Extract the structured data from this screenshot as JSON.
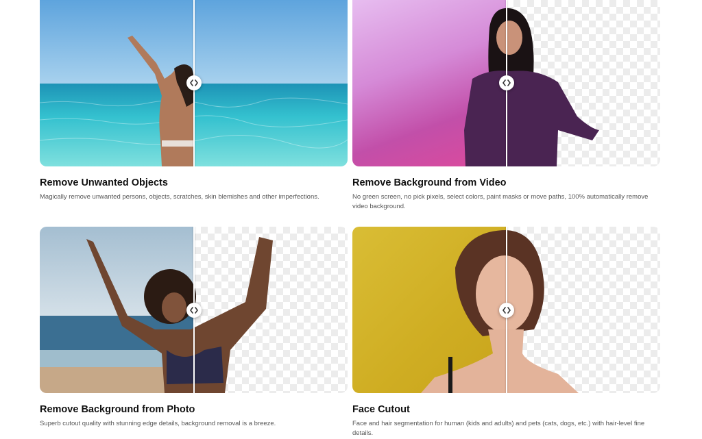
{
  "features": [
    {
      "title": "Remove Unwanted Objects",
      "description": "Magically remove unwanted persons, objects, scratches, skin blemishes and other imperfections.",
      "compare_position": 0.5,
      "handle_icon": "chevrons-left-right-icon"
    },
    {
      "title": "Remove Background from Video",
      "description": "No green screen, no pick pixels, select colors, paint masks or move paths, 100% automatically remove video background.",
      "compare_position": 0.5,
      "handle_icon": "chevrons-left-right-icon"
    },
    {
      "title": "Remove Background from Photo",
      "description": "Superb cutout quality with stunning edge details, background removal is a breeze.",
      "compare_position": 0.5,
      "handle_icon": "chevrons-left-right-icon"
    },
    {
      "title": "Face Cutout",
      "description": "Face and hair segmentation for human (kids and adults) and pets (cats, dogs, etc.) with hair-level fine details.",
      "compare_position": 0.5,
      "handle_icon": "chevrons-left-right-icon"
    }
  ],
  "colors": {
    "title_text": "#111111",
    "description_text": "#555555",
    "sea_top": "#6fb0e3",
    "sea_water": "#2fb6c4",
    "video_bg_left": "#e3b7ee",
    "video_bg_right": "#b246b6",
    "face_bg": "#d1b22a"
  }
}
